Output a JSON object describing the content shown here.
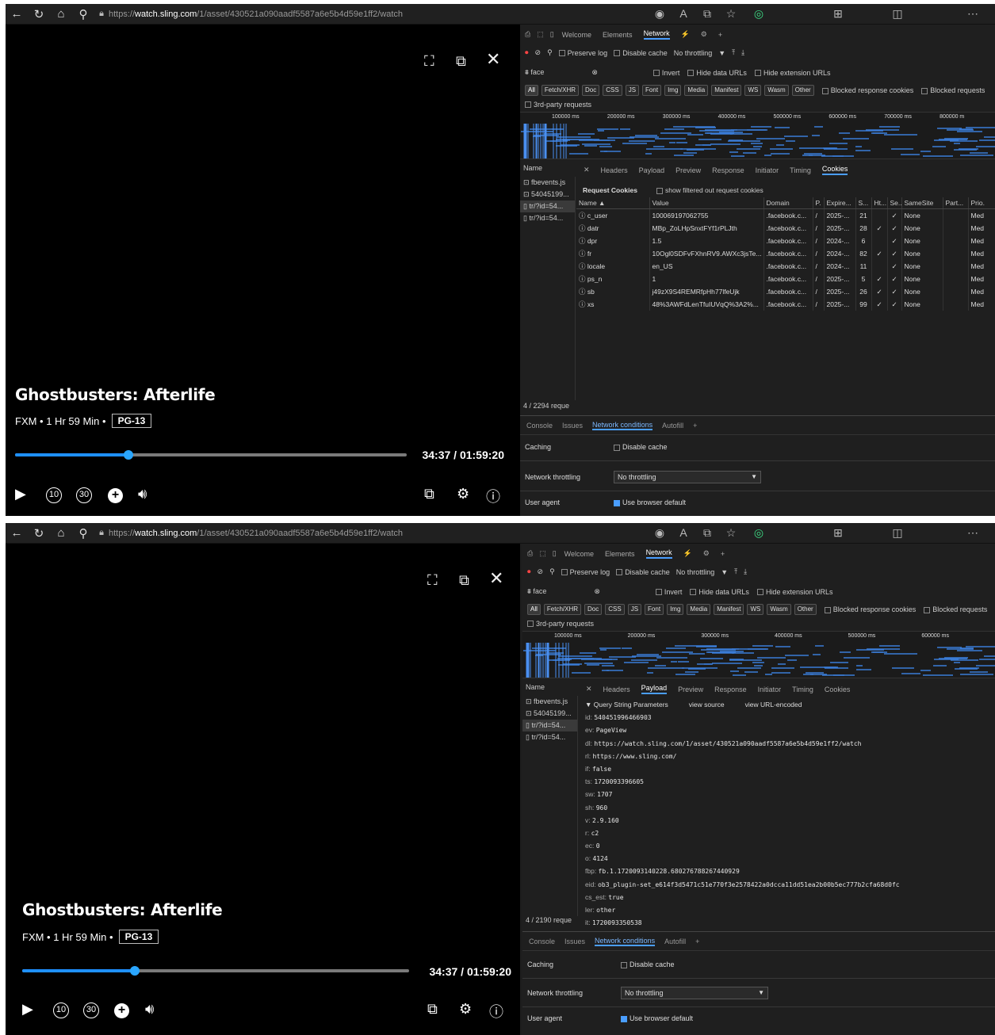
{
  "browser": {
    "url_prefix": "https://",
    "url_host": "watch.sling.com",
    "url_path": "/1/asset/430521a090aadf5587a6e5b4d59e1ff2/watch"
  },
  "player": {
    "title": "Ghostbusters: Afterlife",
    "meta": "FXM • 1 Hr 59 Min •",
    "rating": "PG-13",
    "time": "34:37 / 01:59:20",
    "progress_fraction": 0.29,
    "skip_back": "10",
    "skip_fwd": "30"
  },
  "devtools": {
    "tabs": [
      "Welcome",
      "Elements",
      "Network"
    ],
    "toolbar": {
      "preserve_log": "Preserve log",
      "disable_cache": "Disable cache",
      "throttling": "No throttling"
    },
    "filter": {
      "text": "face",
      "invert": "Invert",
      "hide_data": "Hide data URLs",
      "hide_ext": "Hide extension URLs"
    },
    "types": [
      "All",
      "Fetch/XHR",
      "Doc",
      "CSS",
      "JS",
      "Font",
      "Img",
      "Media",
      "Manifest",
      "WS",
      "Wasm",
      "Other"
    ],
    "blocked_cookies": "Blocked response cookies",
    "blocked_requests": "Blocked requests",
    "third_party": "3rd-party requests",
    "ticks1": [
      "100000 ms",
      "200000 ms",
      "300000 ms",
      "400000 ms",
      "500000 ms",
      "600000 ms",
      "700000 ms",
      "800000 m"
    ],
    "ticks2": [
      "100000 ms",
      "200000 ms",
      "300000 ms",
      "400000 ms",
      "500000 ms",
      "600000 ms"
    ],
    "name_header": "Name",
    "requests": [
      "fbevents.js",
      "54045199...",
      "tr/?id=54...",
      "tr/?id=54..."
    ],
    "detail_tabs": [
      "Headers",
      "Payload",
      "Preview",
      "Response",
      "Initiator",
      "Timing",
      "Cookies"
    ],
    "status1": "4 / 2294 reque",
    "status2": "4 / 2190 reque",
    "cookies": {
      "section": "Request Cookies",
      "show_filtered": "show filtered out request cookies",
      "columns": [
        "Name",
        "Value",
        "Domain",
        "P.",
        "Expire...",
        "S...",
        "Ht...",
        "Se...",
        "SameSite",
        "Part...",
        "Prio."
      ],
      "rows": [
        [
          "c_user",
          "100069197062755",
          ".facebook.c...",
          "/",
          "2025-...",
          "21",
          "",
          "✓",
          "None",
          "",
          "Med"
        ],
        [
          "datr",
          "MBp_ZoLHpSnxtFYf1rPLJth",
          ".facebook.c...",
          "/",
          "2025-...",
          "28",
          "✓",
          "✓",
          "None",
          "",
          "Med"
        ],
        [
          "dpr",
          "1.5",
          ".facebook.c...",
          "/",
          "2024-...",
          "6",
          "",
          "✓",
          "None",
          "",
          "Med"
        ],
        [
          "fr",
          "10Ogl0SDFvFXhnRV9.AWXc3jsTe...",
          ".facebook.c...",
          "/",
          "2024-...",
          "82",
          "✓",
          "✓",
          "None",
          "",
          "Med"
        ],
        [
          "locale",
          "en_US",
          ".facebook.c...",
          "/",
          "2024-...",
          "11",
          "",
          "✓",
          "None",
          "",
          "Med"
        ],
        [
          "ps_n",
          "1",
          ".facebook.c...",
          "/",
          "2025-...",
          "5",
          "✓",
          "✓",
          "None",
          "",
          "Med"
        ],
        [
          "sb",
          "j49zX9S4REMRfpHh77lfeUjk",
          ".facebook.c...",
          "/",
          "2025-...",
          "26",
          "✓",
          "✓",
          "None",
          "",
          "Med"
        ],
        [
          "xs",
          "48%3AWFdLenTfuIUVqQ%3A2%...",
          ".facebook.c...",
          "/",
          "2025-...",
          "99",
          "✓",
          "✓",
          "None",
          "",
          "Med"
        ]
      ]
    },
    "payload": {
      "section": "▼ Query String Parameters",
      "view_source": "view source",
      "view_url": "view URL-encoded",
      "params": [
        [
          "id:",
          "540451996466903"
        ],
        [
          "ev:",
          "PageView"
        ],
        [
          "dl:",
          "https://watch.sling.com/1/asset/430521a090aadf5587a6e5b4d59e1ff2/watch"
        ],
        [
          "rl:",
          "https://www.sling.com/"
        ],
        [
          "if:",
          "false"
        ],
        [
          "ts:",
          "1720093396605"
        ],
        [
          "sw:",
          "1707"
        ],
        [
          "sh:",
          "960"
        ],
        [
          "v:",
          "2.9.160"
        ],
        [
          "r:",
          "c2"
        ],
        [
          "ec:",
          "0"
        ],
        [
          "o:",
          "4124"
        ],
        [
          "fbp:",
          "fb.1.1720093140228.680276788267440929"
        ],
        [
          "eid:",
          "ob3_plugin-set_e614f3d5471c51e770f3e2578422a0dcca11dd51ea2b00b5ec777b2cfa68d0fc"
        ],
        [
          "cs_est:",
          "true"
        ],
        [
          "ler:",
          "other"
        ],
        [
          "it:",
          "1720093350538"
        ]
      ]
    },
    "drawer": {
      "tabs": [
        "Console",
        "Issues",
        "Network conditions",
        "Autofill"
      ],
      "caching": "Caching",
      "disable_cache": "Disable cache",
      "throttling_label": "Network throttling",
      "throttling_value": "No throttling",
      "ua_label": "User agent",
      "ua_value": "Use browser default"
    }
  }
}
